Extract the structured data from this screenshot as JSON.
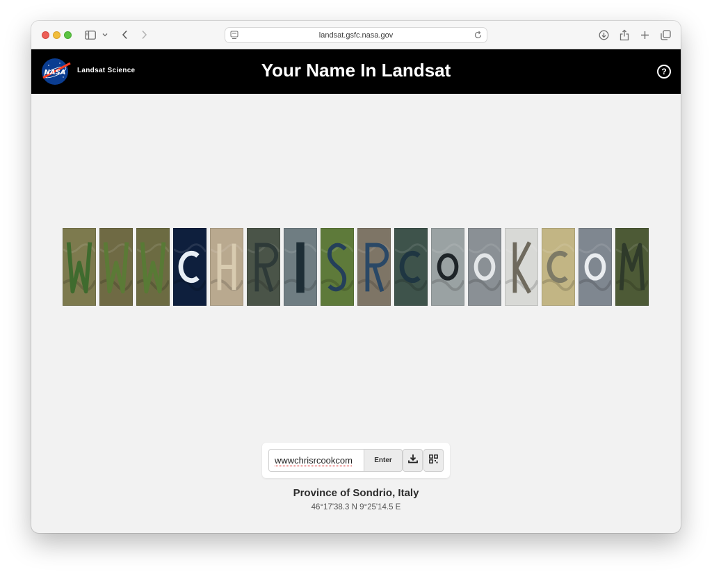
{
  "browser": {
    "url": "landsat.gsfc.nasa.gov"
  },
  "header": {
    "logo_text": "NASA",
    "brand": "Landsat Science",
    "title": "Your Name In Landsat",
    "help_symbol": "?"
  },
  "tiles": [
    {
      "letter": "W",
      "bg": "#7d7a4e",
      "accent": "#3f6b2e"
    },
    {
      "letter": "W",
      "bg": "#6f6a44",
      "accent": "#5b7a36"
    },
    {
      "letter": "W",
      "bg": "#6c6b42",
      "accent": "#587a35"
    },
    {
      "letter": "C",
      "bg": "#0e1f3d",
      "accent": "#e8eef5"
    },
    {
      "letter": "H",
      "bg": "#b9a98f",
      "accent": "#d8cbb0"
    },
    {
      "letter": "R",
      "bg": "#4a5448",
      "accent": "#2e3a38"
    },
    {
      "letter": "I",
      "bg": "#6f7d82",
      "accent": "#1e2e36"
    },
    {
      "letter": "S",
      "bg": "#5e7a3a",
      "accent": "#243f5a"
    },
    {
      "letter": "R",
      "bg": "#7e7566",
      "accent": "#2a4866"
    },
    {
      "letter": "C",
      "bg": "#3e534b",
      "accent": "#1f3642"
    },
    {
      "letter": "O",
      "bg": "#9aa2a3",
      "accent": "#1e2428"
    },
    {
      "letter": "O",
      "bg": "#8a9095",
      "accent": "#e3e6e8"
    },
    {
      "letter": "K",
      "bg": "#d8d9d6",
      "accent": "#6f6a5e"
    },
    {
      "letter": "C",
      "bg": "#c2b584",
      "accent": "#7d7a66"
    },
    {
      "letter": "O",
      "bg": "#7f8790",
      "accent": "#eaedf0"
    },
    {
      "letter": "M",
      "bg": "#4d5a36",
      "accent": "#2f3a2a"
    }
  ],
  "controls": {
    "input_value": "wwwchrisrcookcom",
    "enter_label": "Enter",
    "download_icon": "download-icon",
    "qr_icon": "qr-code-icon"
  },
  "location": {
    "name": "Province of Sondrio, Italy",
    "coordinates": "46°17'38.3 N 9°25'14.5 E"
  }
}
